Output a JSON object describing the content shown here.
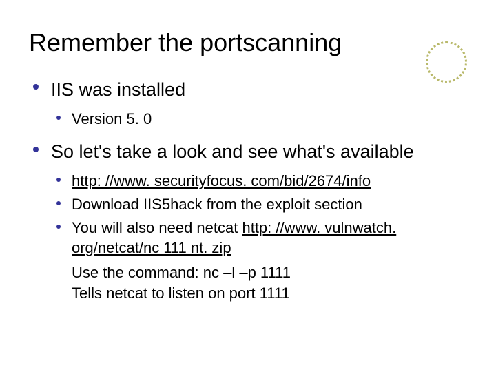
{
  "slide": {
    "title": "Remember the portscanning",
    "bullets": [
      {
        "text": "IIS was installed",
        "sub": [
          {
            "text": "Version 5. 0"
          }
        ]
      },
      {
        "text": "So let's take a look and see what's available",
        "sub": [
          {
            "text": "http: //www. securityfocus. com/bid/2674/info",
            "underline": true
          },
          {
            "text": "Download IIS5hack from the exploit section"
          },
          {
            "text_pre": "You will also need netcat ",
            "text_link": "http: //www. vulnwatch. org/netcat/nc 111 nt. zip"
          }
        ],
        "plain": [
          "Use the command: nc –l –p 1111",
          "Tells netcat to listen on port 1111"
        ]
      }
    ]
  }
}
